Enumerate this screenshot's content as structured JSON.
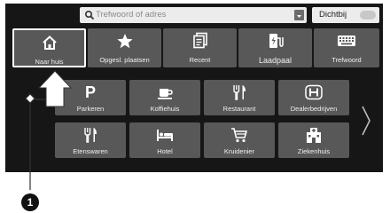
{
  "search": {
    "placeholder": "Trefwoord of adres"
  },
  "nearby": {
    "label": "Dichtbij"
  },
  "row1": [
    {
      "label": "Naar huis",
      "icon": "home-icon"
    },
    {
      "label": "Opgesl. plaatsen",
      "icon": "star-icon"
    },
    {
      "label": "Recent",
      "icon": "recent-icon"
    },
    {
      "label": "Laadpaal",
      "icon": "charging-station-icon"
    },
    {
      "label": "Trefwoord",
      "icon": "keyboard-icon"
    }
  ],
  "row2": [
    {
      "label": "Parkeren",
      "icon": "parking-icon"
    },
    {
      "label": "Koffiehuis",
      "icon": "coffee-icon"
    },
    {
      "label": "Restaurant",
      "icon": "restaurant-icon"
    },
    {
      "label": "Dealerbedrijven",
      "icon": "honda-dealer-icon"
    }
  ],
  "row3": [
    {
      "label": "Etenswaren",
      "icon": "food-icon"
    },
    {
      "label": "Hotel",
      "icon": "hotel-icon"
    },
    {
      "label": "Kruidenier",
      "icon": "grocery-cart-icon"
    },
    {
      "label": "Ziekenhuis",
      "icon": "hospital-icon"
    }
  ],
  "page_indicator": {
    "current": 1,
    "total": 2
  },
  "callout": {
    "number": "1"
  },
  "colors": {
    "screen_bg": "#161616",
    "tile_bg": "#585858",
    "selected_border": "#ffffff"
  }
}
